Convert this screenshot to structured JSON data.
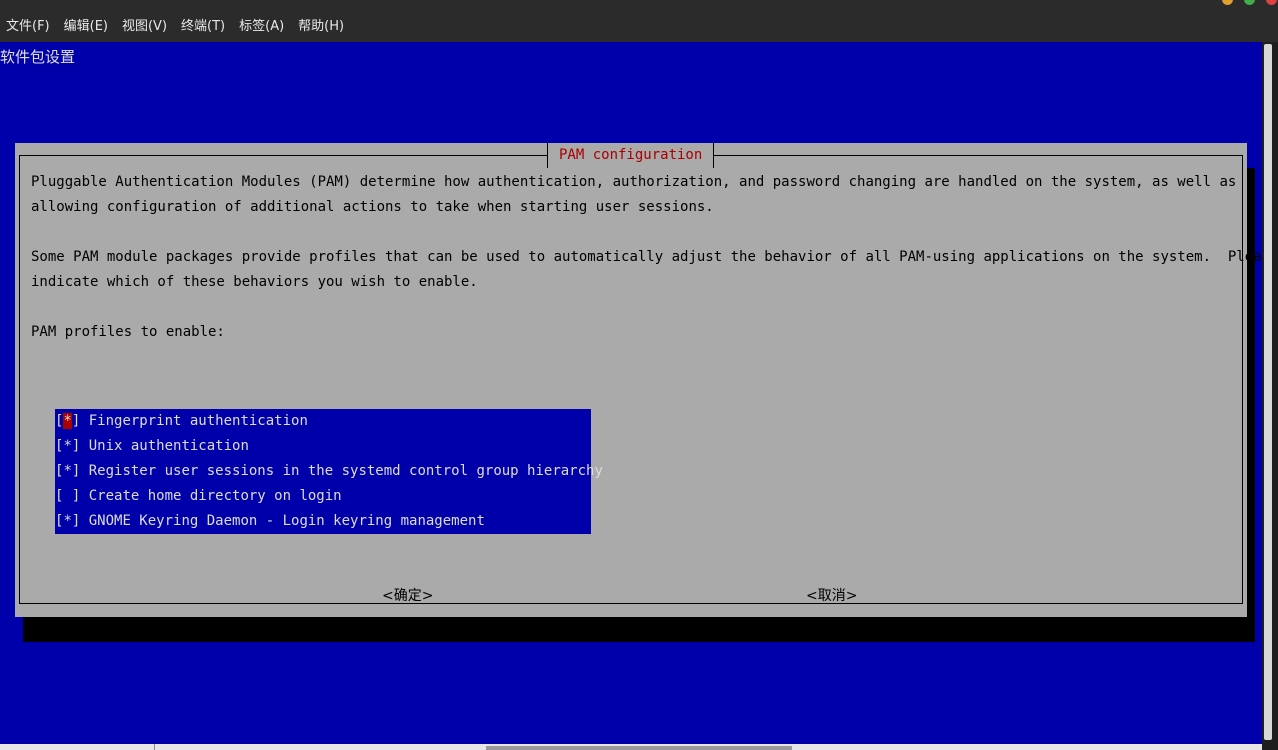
{
  "menubar": {
    "items": [
      "文件(F)",
      "编辑(E)",
      "视图(V)",
      "终端(T)",
      "标签(A)",
      "帮助(H)"
    ]
  },
  "terminal": {
    "backtitle": "软件包设置"
  },
  "dialog": {
    "title": "PAM configuration",
    "description_lines": [
      "Pluggable Authentication Modules (PAM) determine how authentication, authorization, and password changing are handled on the system, as well as",
      "allowing configuration of additional actions to take when starting user sessions.",
      "Some PAM module packages provide profiles that can be used to automatically adjust the behavior of all PAM-using applications on the system.  Please",
      "indicate which of these behaviors you wish to enable."
    ],
    "prompt": "PAM profiles to enable:",
    "profiles": [
      {
        "mark": "*",
        "label": "Fingerprint authentication",
        "checked": true
      },
      {
        "mark": "*",
        "label": "Unix authentication",
        "checked": true
      },
      {
        "mark": "*",
        "label": "Register user sessions in the systemd control group hierarchy",
        "checked": true
      },
      {
        "mark": " ",
        "label": "Create home directory on login",
        "checked": false
      },
      {
        "mark": "*",
        "label": "GNOME Keyring Daemon - Login keyring management",
        "checked": true
      }
    ],
    "ok_label": "<确定>",
    "cancel_label": "<取消>"
  },
  "colors": {
    "terminal_bg": "#0000aa",
    "dialog_bg": "#aaaaaa",
    "title_fg": "#aa0000",
    "selection_bg": "#0000aa",
    "cursor_bg": "#aa0000"
  }
}
